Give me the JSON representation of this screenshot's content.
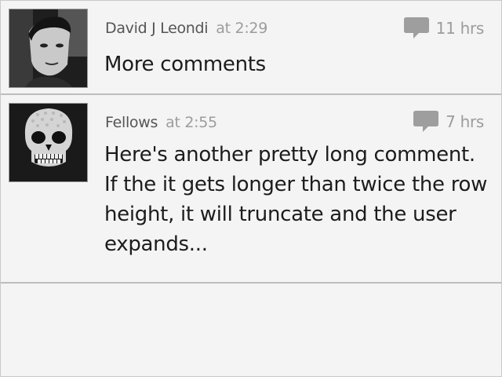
{
  "comments": [
    {
      "author": "David J Leondi",
      "time": "at 2:29",
      "age": "11 hrs",
      "text": "More comments",
      "avatar": "photo-avatar",
      "icon": "speech-bubble-icon"
    },
    {
      "author": "Fellows",
      "time": "at 2:55",
      "age": "7 hrs",
      "text": "Here's another pretty long comment. If the it gets longer than twice the row height, it will truncate and the user expands...",
      "avatar": "skull-avatar",
      "icon": "speech-bubble-icon"
    }
  ],
  "colors": {
    "background": "#f4f4f4",
    "divider": "#bdbdbd",
    "author": "#555555",
    "muted": "#9c9c9c",
    "text": "#1c1c1c",
    "icon": "#9e9e9e"
  }
}
